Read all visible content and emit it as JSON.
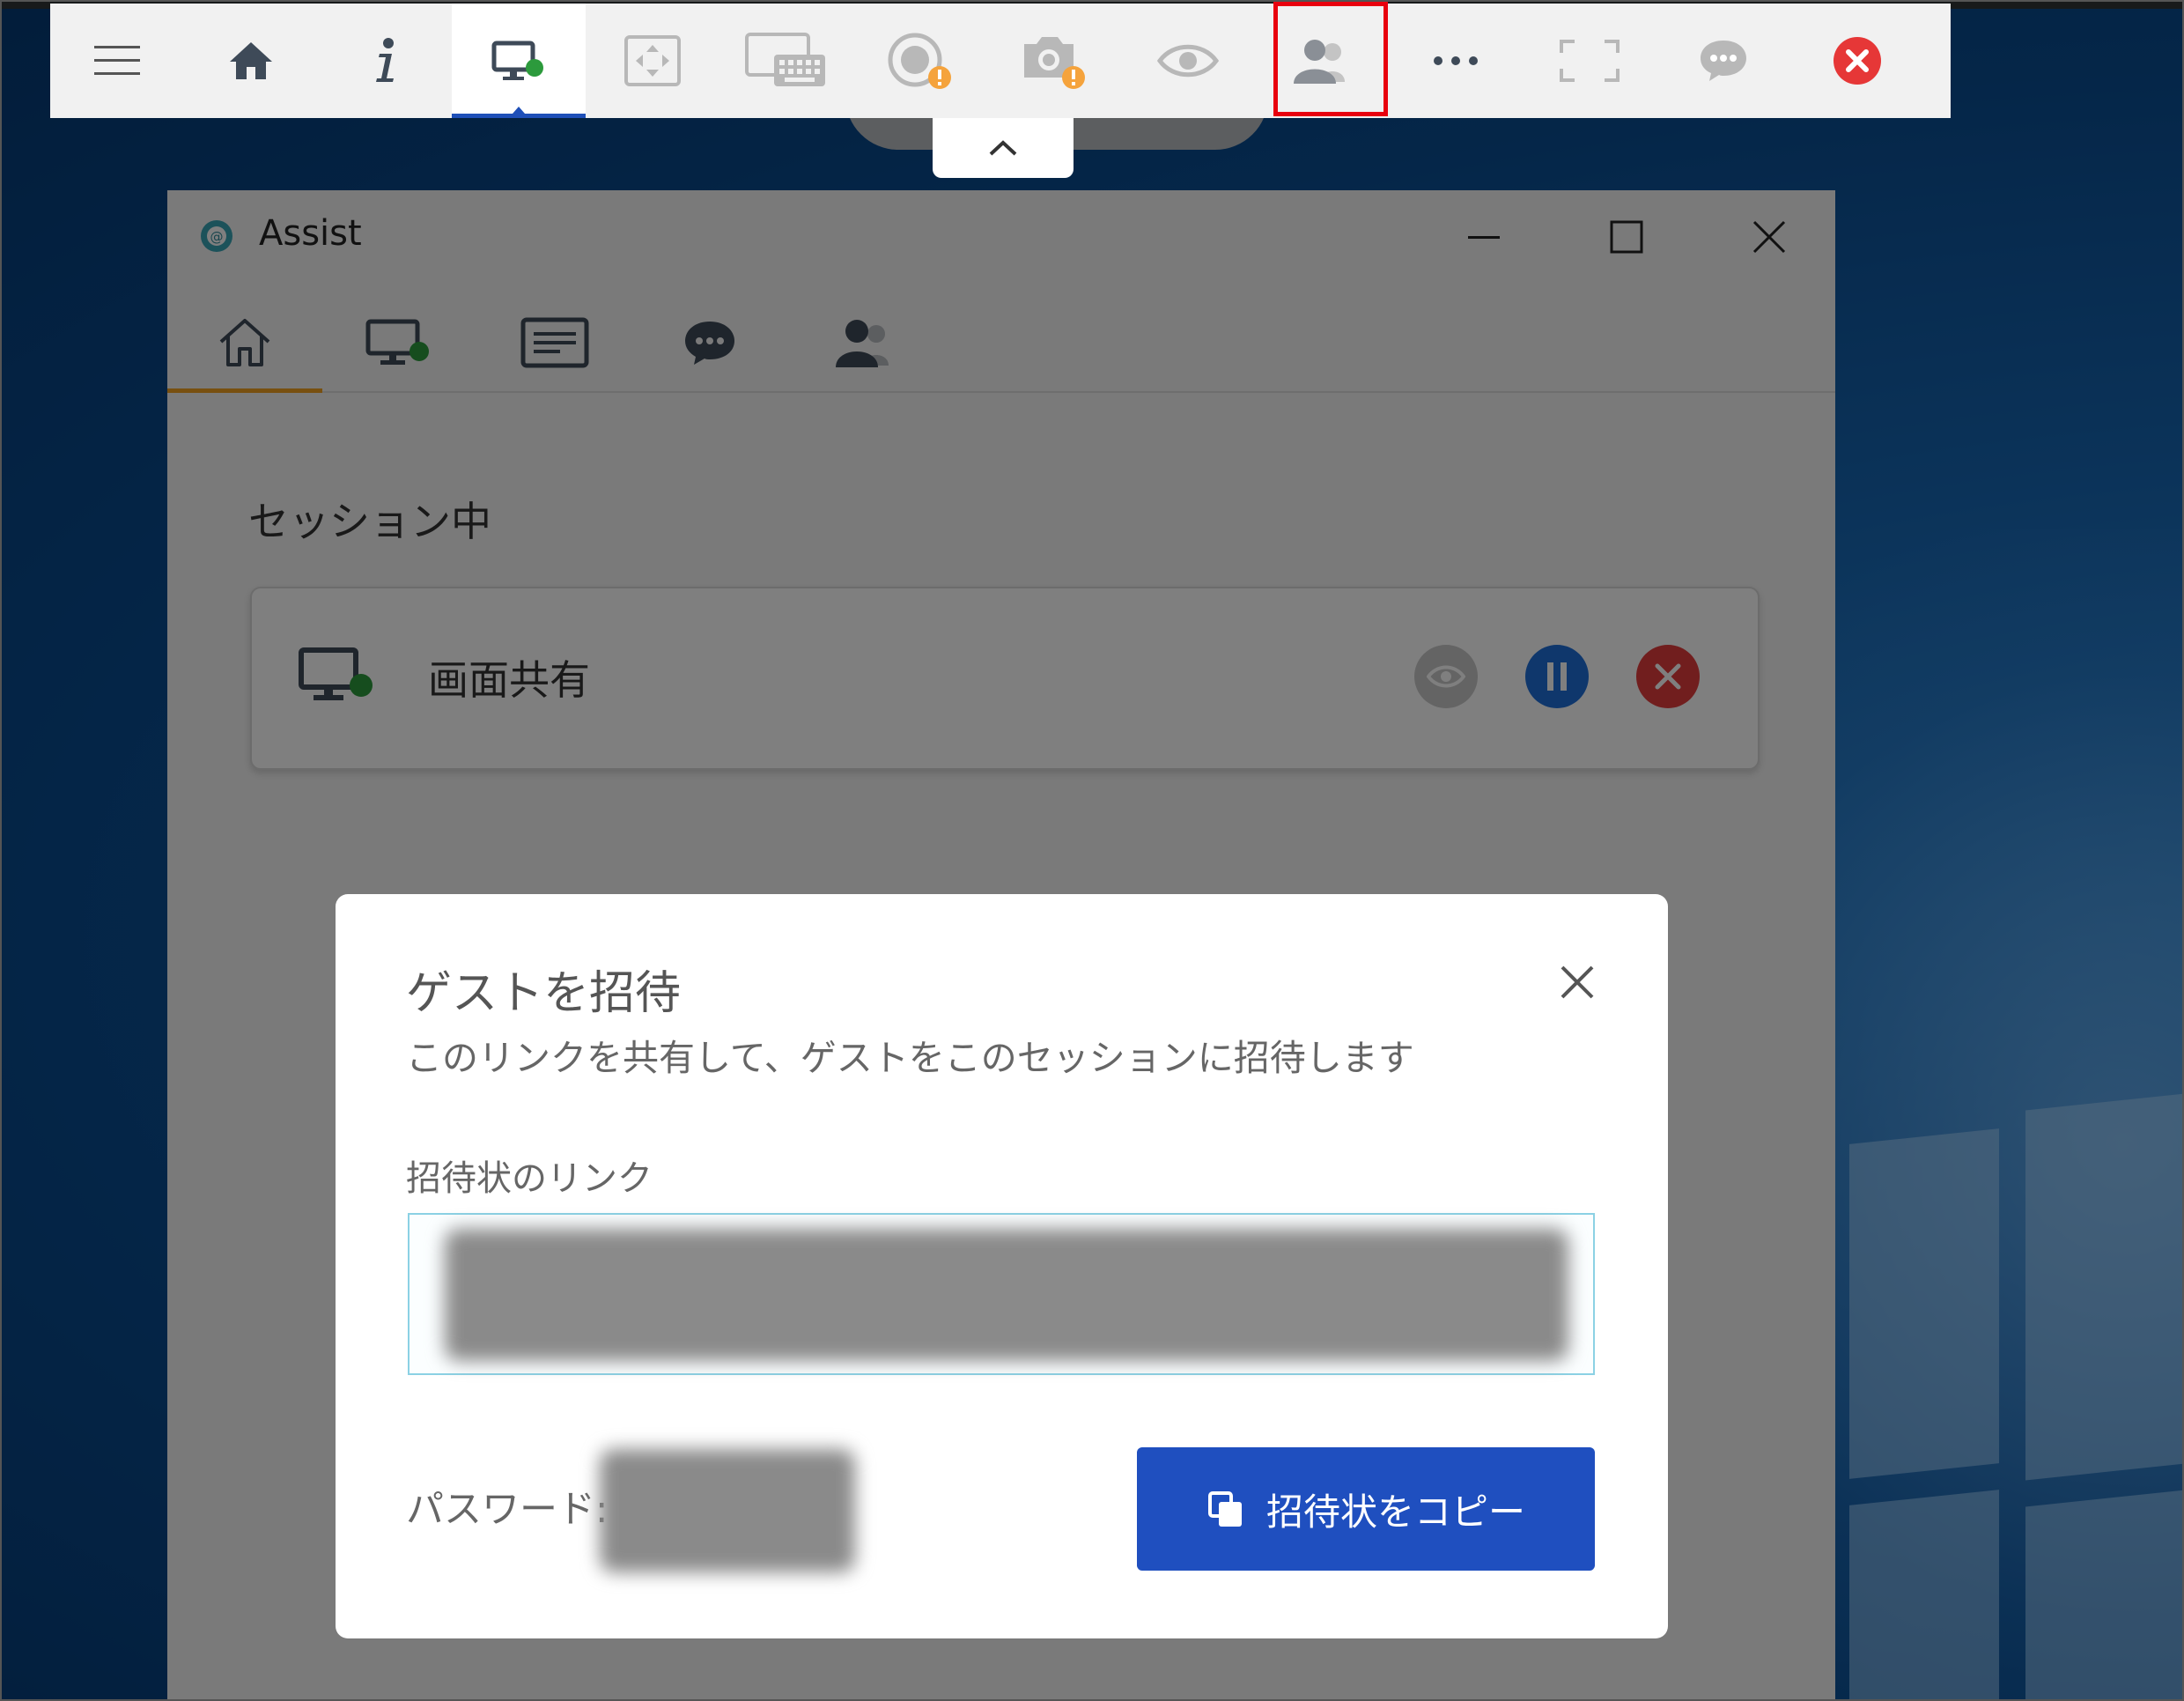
{
  "toolbar": {
    "items": [
      {
        "name": "menu",
        "icon": "hamburger-menu-icon"
      },
      {
        "name": "home",
        "icon": "home-icon"
      },
      {
        "name": "info",
        "icon": "info-icon"
      },
      {
        "name": "screen-share",
        "icon": "monitor-online-icon",
        "active": true
      },
      {
        "name": "fit-screen",
        "icon": "fit-to-screen-icon"
      },
      {
        "name": "keyboard",
        "icon": "keyboard-icon"
      },
      {
        "name": "record",
        "icon": "record-warning-icon"
      },
      {
        "name": "screenshot",
        "icon": "camera-warning-icon"
      },
      {
        "name": "view-only",
        "icon": "eye-icon"
      },
      {
        "name": "invite-guest",
        "icon": "users-icon",
        "highlighted": true
      },
      {
        "name": "more",
        "icon": "more-horizontal-icon"
      },
      {
        "name": "fullscreen",
        "icon": "fullscreen-icon"
      },
      {
        "name": "chat",
        "icon": "chat-bubble-icon"
      },
      {
        "name": "end-session",
        "icon": "close-circle-icon"
      }
    ],
    "collapse_icon": "chevron-up-icon",
    "highlight_color": "#e8000e"
  },
  "app": {
    "title": "Assist",
    "tabs": [
      {
        "name": "home",
        "icon": "home-outline-icon",
        "active": true
      },
      {
        "name": "screen",
        "icon": "monitor-online-icon"
      },
      {
        "name": "files",
        "icon": "document-icon"
      },
      {
        "name": "chat",
        "icon": "chat-bubble-icon"
      },
      {
        "name": "participants",
        "icon": "users-icon"
      }
    ],
    "section_title": "セッション中",
    "session": {
      "label": "画面共有",
      "icon": "monitor-online-icon",
      "actions": [
        "eye-icon",
        "pause-icon",
        "close-icon"
      ]
    }
  },
  "modal": {
    "title": "ゲストを招待",
    "subtitle": "このリンクを共有して、ゲストをこのセッションに招待します",
    "link_label": "招待状のリンク",
    "password_label": "パスワード:",
    "copy_button": "招待状をコピー",
    "accent": "#1f4fbf"
  }
}
